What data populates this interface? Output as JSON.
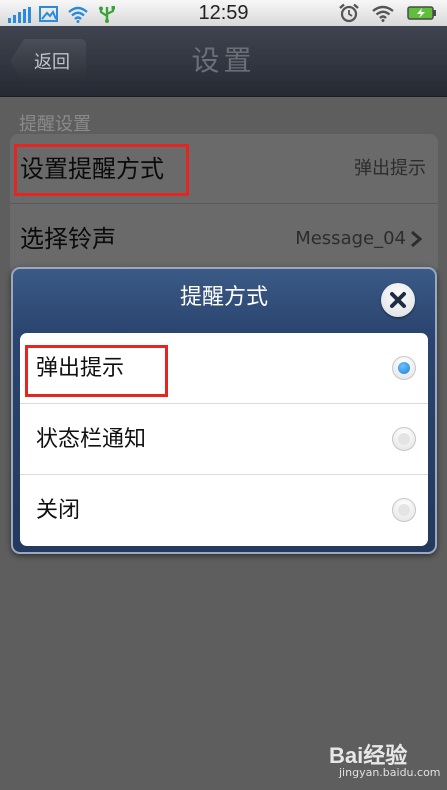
{
  "status_bar": {
    "time": "12:59"
  },
  "nav": {
    "back_label": "返回",
    "title": "设置"
  },
  "settings": {
    "section_header": "提醒设置",
    "rows": [
      {
        "label": "设置提醒方式",
        "value": "弹出提示"
      },
      {
        "label": "选择铃声",
        "value": "Message_04"
      }
    ]
  },
  "dialog": {
    "title": "提醒方式",
    "options": [
      {
        "label": "弹出提示",
        "selected": true
      },
      {
        "label": "状态栏通知",
        "selected": false
      },
      {
        "label": "关闭",
        "selected": false
      }
    ]
  },
  "watermark": {
    "logo": "Bai经验",
    "url": "jingyan.baidu.com"
  },
  "colors": {
    "highlight": "#e52521",
    "nav_bg": "#2f333c",
    "dialog_bg": "#2a4570",
    "radio_selected": "#1b7fdc"
  },
  "icons": {
    "status_left": [
      "signal-icon",
      "image-icon",
      "wifi-icon",
      "usb-icon"
    ],
    "status_right": [
      "alarm-icon",
      "wifi-icon",
      "battery-charging-icon"
    ],
    "close": "close-icon",
    "chevron": "chevron-right-icon"
  }
}
